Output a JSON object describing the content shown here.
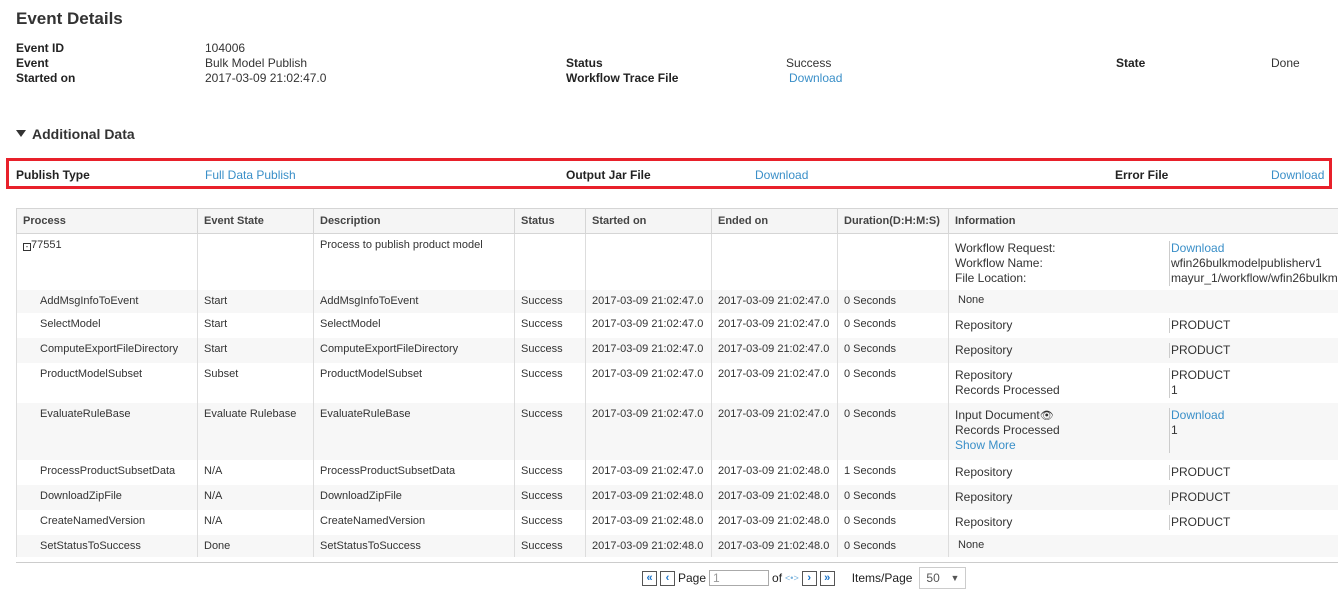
{
  "title": "Event Details",
  "event": {
    "id_label": "Event ID",
    "id": "104006",
    "event_label": "Event",
    "event": "Bulk Model Publish",
    "started_label": "Started on",
    "started": "2017-03-09 21:02:47.0",
    "status_label": "Status",
    "status": "Success",
    "trace_label": "Workflow Trace File",
    "trace": "Download",
    "state_label": "State",
    "state": "Done"
  },
  "additional": {
    "title": "Additional Data",
    "publish_type_label": "Publish Type",
    "publish_type": "Full Data Publish",
    "jar_label": "Output Jar File",
    "jar": "Download",
    "error_label": "Error File",
    "error": "Download"
  },
  "table": {
    "headers": [
      "Process",
      "Event State",
      "Description",
      "Status",
      "Started on",
      "Ended on",
      "Duration(D:H:M:S)",
      "Information"
    ],
    "parent": {
      "process": "77551",
      "description": "Process to publish product model",
      "info": [
        [
          "Workflow Request:",
          "Download",
          true
        ],
        [
          "Workflow Name:",
          "wfin26bulkmodelpublisherv1",
          false
        ],
        [
          "File Location:",
          "mayur_1/workflow/wfin26bulkm",
          false
        ]
      ]
    },
    "rows": [
      {
        "process": "AddMsgInfoToEvent",
        "state": "Start",
        "desc": "AddMsgInfoToEvent",
        "status": "Success",
        "start": "2017-03-09 21:02:47.0",
        "end": "2017-03-09 21:02:47.0",
        "dur": "0 Seconds",
        "none": "None"
      },
      {
        "process": "SelectModel",
        "state": "Start",
        "desc": "SelectModel",
        "status": "Success",
        "start": "2017-03-09 21:02:47.0",
        "end": "2017-03-09 21:02:47.0",
        "dur": "0 Seconds",
        "info": [
          [
            "Repository",
            "PRODUCT",
            false
          ]
        ]
      },
      {
        "process": "ComputeExportFileDirectory",
        "state": "Start",
        "desc": "ComputeExportFileDirectory",
        "status": "Success",
        "start": "2017-03-09 21:02:47.0",
        "end": "2017-03-09 21:02:47.0",
        "dur": "0 Seconds",
        "info": [
          [
            "Repository",
            "PRODUCT",
            false
          ]
        ]
      },
      {
        "process": "ProductModelSubset",
        "state": "Subset",
        "desc": "ProductModelSubset",
        "status": "Success",
        "start": "2017-03-09 21:02:47.0",
        "end": "2017-03-09 21:02:47.0",
        "dur": "0 Seconds",
        "info": [
          [
            "Repository",
            "PRODUCT",
            false
          ],
          [
            "Records Processed",
            "1",
            false
          ]
        ]
      },
      {
        "process": "EvaluateRuleBase",
        "state": "Evaluate Rulebase",
        "desc": "EvaluateRuleBase",
        "status": "Success",
        "start": "2017-03-09 21:02:47.0",
        "end": "2017-03-09 21:02:47.0",
        "dur": "0 Seconds",
        "info": [
          [
            "Input Document",
            "Download",
            true,
            "eye-icon"
          ],
          [
            "Records Processed",
            "1",
            false
          ]
        ],
        "more": "Show More"
      },
      {
        "process": "ProcessProductSubsetData",
        "state": "N/A",
        "desc": "ProcessProductSubsetData",
        "status": "Success",
        "start": "2017-03-09 21:02:47.0",
        "end": "2017-03-09 21:02:48.0",
        "dur": "1 Seconds",
        "info": [
          [
            "Repository",
            "PRODUCT",
            false
          ]
        ]
      },
      {
        "process": "DownloadZipFile",
        "state": "N/A",
        "desc": "DownloadZipFile",
        "status": "Success",
        "start": "2017-03-09 21:02:48.0",
        "end": "2017-03-09 21:02:48.0",
        "dur": "0 Seconds",
        "info": [
          [
            "Repository",
            "PRODUCT",
            false
          ]
        ]
      },
      {
        "process": "CreateNamedVersion",
        "state": "N/A",
        "desc": "CreateNamedVersion",
        "status": "Success",
        "start": "2017-03-09 21:02:48.0",
        "end": "2017-03-09 21:02:48.0",
        "dur": "0 Seconds",
        "info": [
          [
            "Repository",
            "PRODUCT",
            false
          ]
        ]
      },
      {
        "process": "SetStatusToSuccess",
        "state": "Done",
        "desc": "SetStatusToSuccess",
        "status": "Success",
        "start": "2017-03-09 21:02:48.0",
        "end": "2017-03-09 21:02:48.0",
        "dur": "0 Seconds",
        "none": "None"
      }
    ]
  },
  "pager": {
    "page_label": "Page",
    "page": "1",
    "of_label": "of",
    "total": "<•>",
    "items_label": "Items/Page",
    "items": "50"
  }
}
